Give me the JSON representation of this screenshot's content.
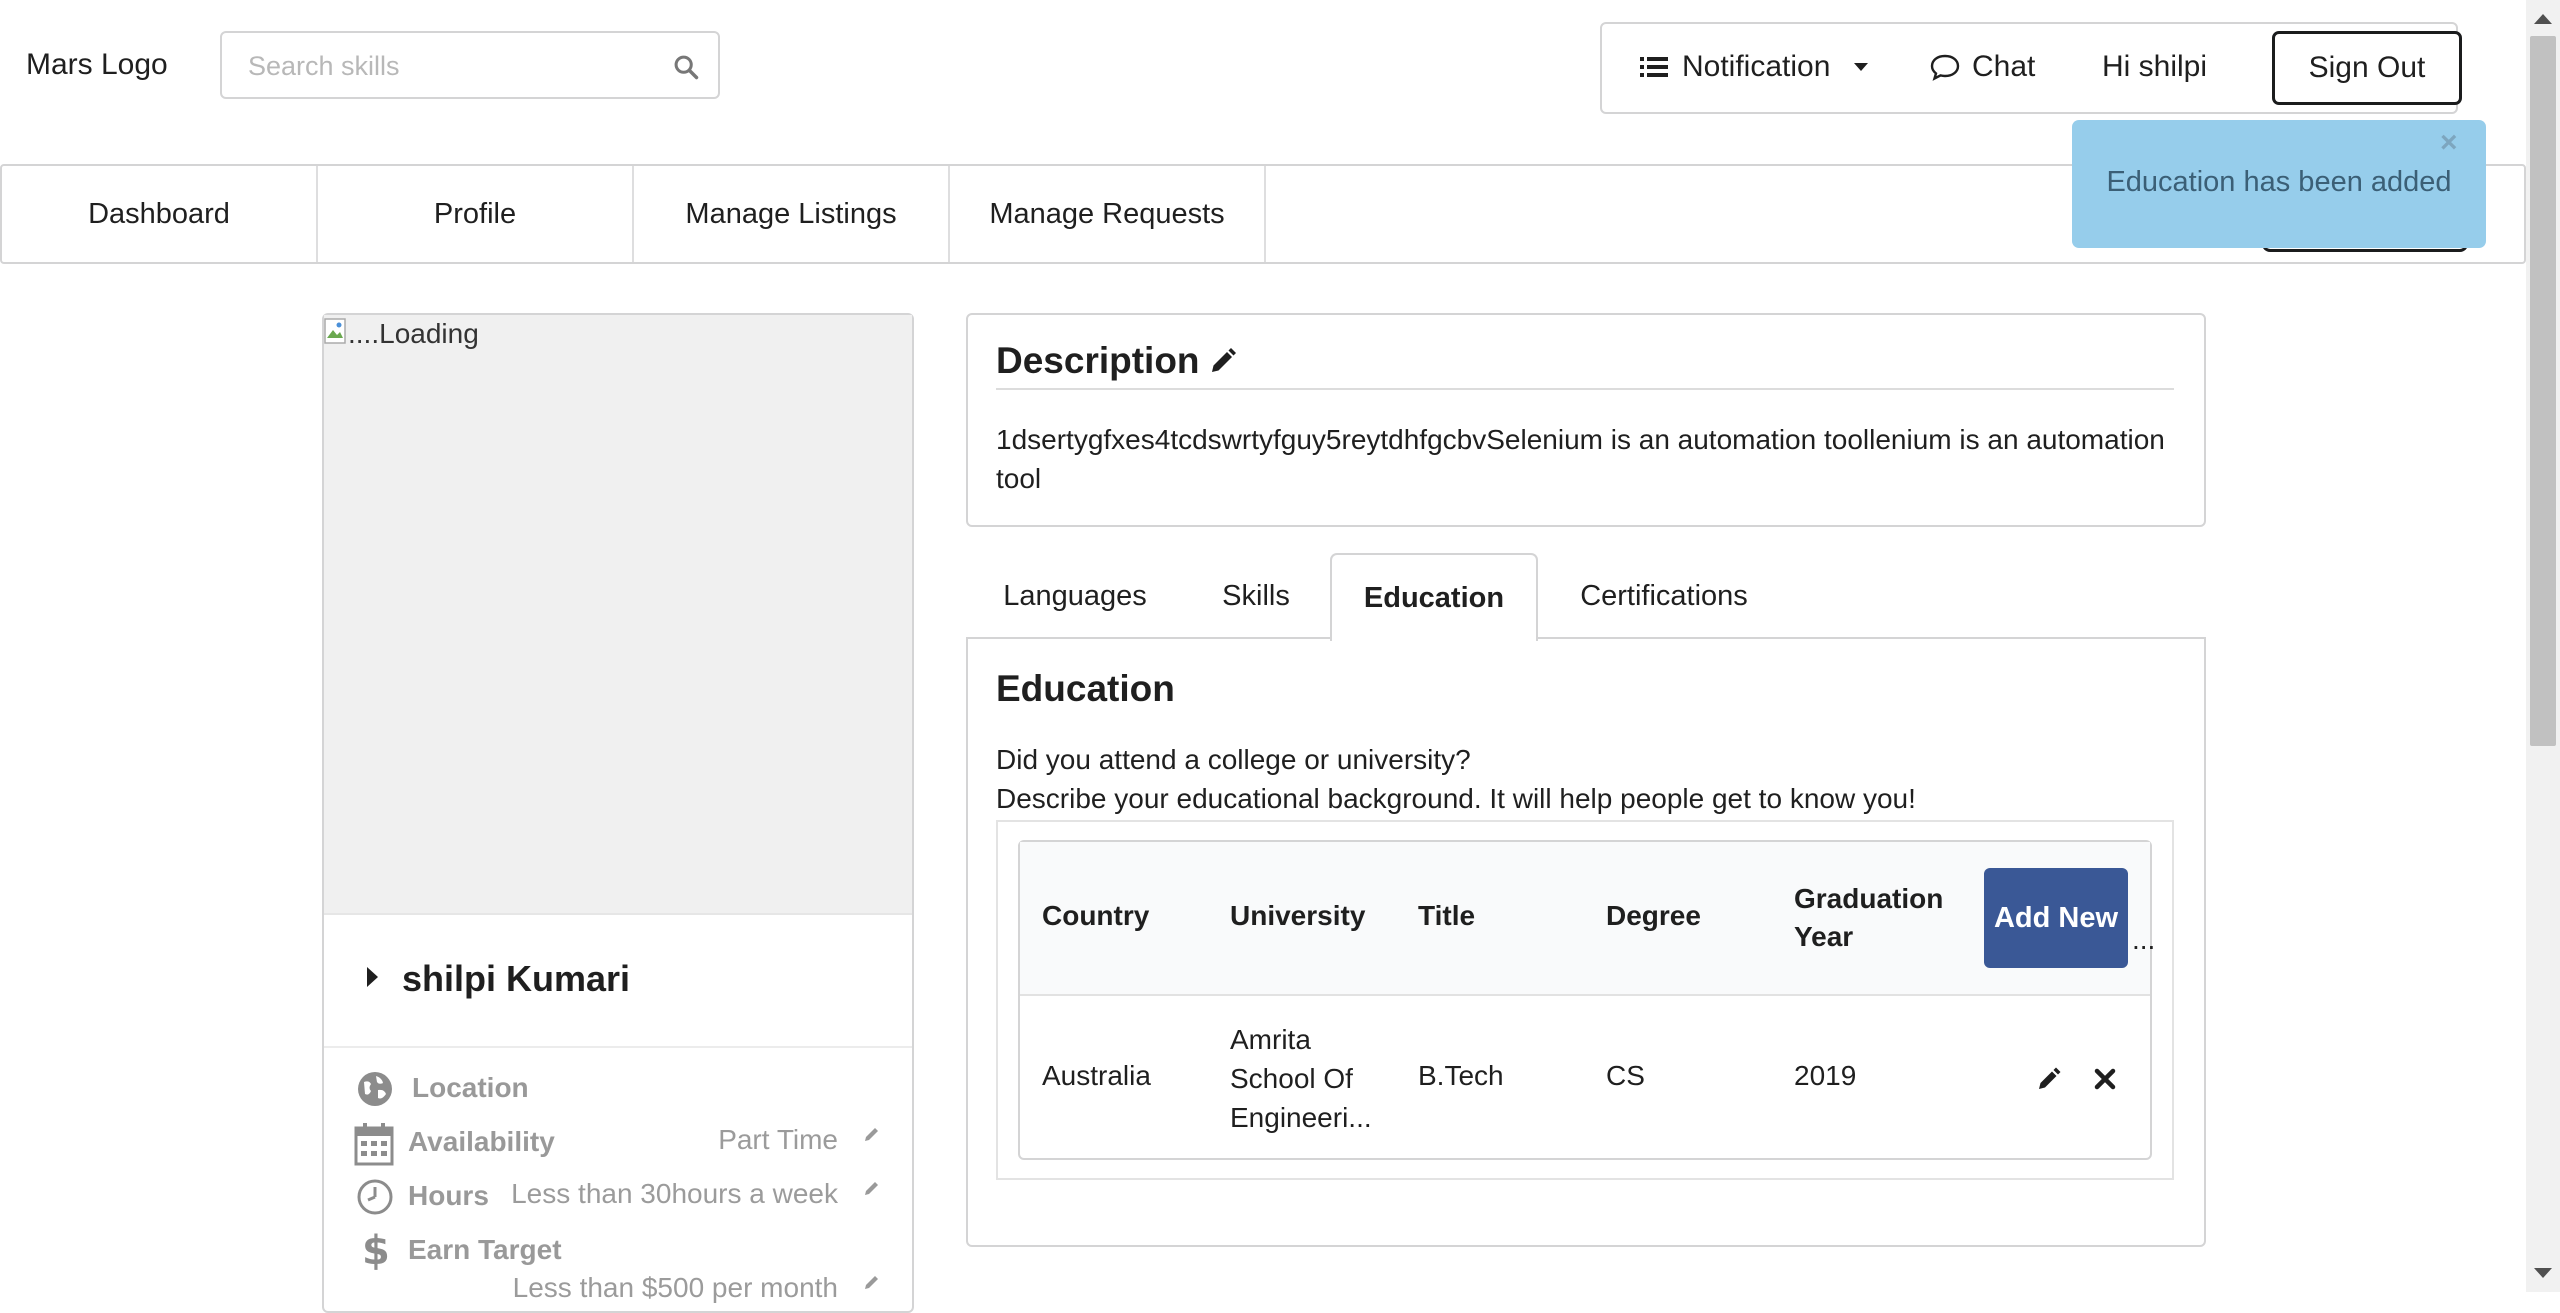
{
  "header": {
    "logo": "Mars Logo",
    "search_placeholder": "Search skills",
    "notification_label": "Notification",
    "chat_label": "Chat",
    "greeting": "Hi shilpi",
    "signout_label": "Sign Out"
  },
  "menu": {
    "items": [
      {
        "label": "Dashboard"
      },
      {
        "label": "Profile"
      },
      {
        "label": "Manage Listings"
      },
      {
        "label": "Manage Requests"
      }
    ]
  },
  "toast": {
    "message": "Education has been added",
    "close": "×"
  },
  "profile": {
    "photo_alt": "....Loading",
    "name": "shilpi Kumari",
    "rows": [
      {
        "icon": "globe-icon",
        "label": "Location",
        "value": ""
      },
      {
        "icon": "calendar-icon",
        "label": "Availability",
        "value": "Part Time"
      },
      {
        "icon": "clock-icon",
        "label": "Hours",
        "value": "Less than 30hours a week"
      },
      {
        "icon": "dollar-icon",
        "label": "Earn Target",
        "value": "Less than $500 per month"
      }
    ]
  },
  "description": {
    "title": "Description",
    "text": "1dsertygfxes4tcdswrtyfguy5reytdhfgcbvSelenium is an automation toollenium is an automation tool"
  },
  "tabs": [
    {
      "label": "Languages",
      "active": false
    },
    {
      "label": "Skills",
      "active": false
    },
    {
      "label": "Education",
      "active": true
    },
    {
      "label": "Certifications",
      "active": false
    }
  ],
  "education": {
    "title": "Education",
    "question": "Did you attend a college or university?",
    "description": "Describe your educational background. It will help people get to know you!",
    "columns": [
      "Country",
      "University",
      "Title",
      "Degree",
      "Graduation Year"
    ],
    "add_new_label": "Add New",
    "overflow": "...",
    "rows": [
      {
        "country": "Australia",
        "university": "Amrita School Of Engineeri...",
        "title": "B.Tech",
        "degree": "CS",
        "year": "2019"
      }
    ]
  },
  "colors": {
    "toast_bg": "#96cdeb",
    "add_new_bg": "#3a5896"
  }
}
